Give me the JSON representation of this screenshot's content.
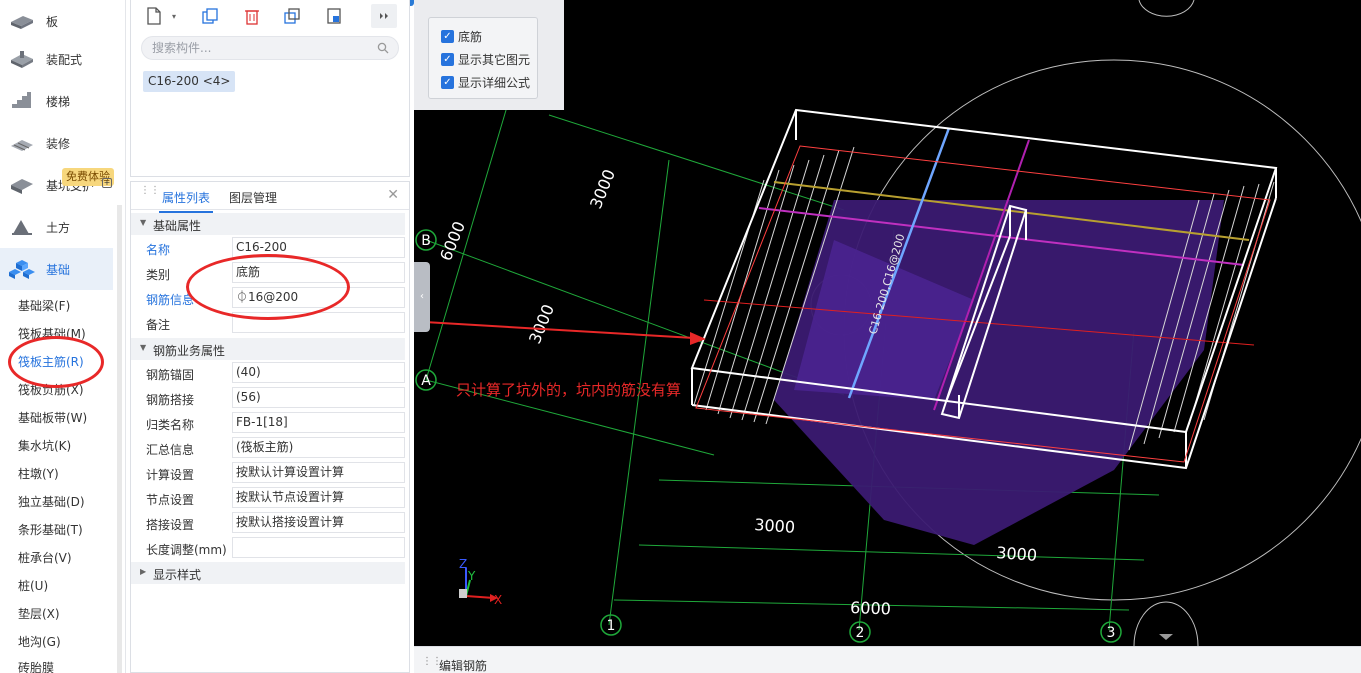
{
  "nav": {
    "items": [
      {
        "label": "板",
        "icon": "slab-icon"
      },
      {
        "label": "装配式",
        "icon": "prefab-icon"
      },
      {
        "label": "楼梯",
        "icon": "stairs-icon"
      },
      {
        "label": "装修",
        "icon": "decoration-icon"
      },
      {
        "label": "基坑支护",
        "icon": "pit-support-icon"
      },
      {
        "label": "土方",
        "icon": "earthwork-icon"
      },
      {
        "label": "基础",
        "icon": "foundation-icon"
      }
    ],
    "free_badge": "免费体验",
    "sub_items": [
      "基础梁(F)",
      "筏板基础(M)",
      "筏板主筋(R)",
      "筏板负筋(X)",
      "基础板带(W)",
      "集水坑(K)",
      "柱墩(Y)",
      "独立基础(D)",
      "条形基础(T)",
      "桩承台(V)",
      "桩(U)",
      "垫层(X)",
      "地沟(G)",
      "砖胎膜"
    ],
    "active_sub": "筏板主筋(R)"
  },
  "component_panel": {
    "search_placeholder": "搜索构件...",
    "component": "C16-200 <4>",
    "toolbar_icons": [
      "new-icon",
      "copy-icon",
      "delete-icon",
      "duplicate-icon",
      "layer-copy-icon",
      "more-icon"
    ]
  },
  "properties": {
    "tabs": [
      "属性列表",
      "图层管理"
    ],
    "groups": {
      "basic": "基础属性",
      "business": "钢筋业务属性",
      "display": "显示样式"
    },
    "basic_rows": [
      {
        "name": "名称",
        "value": "C16-200",
        "blue": true
      },
      {
        "name": "类别",
        "value": "底筋",
        "blue": false
      },
      {
        "name": "钢筋信息",
        "value": "⏀16@200",
        "blue": true
      },
      {
        "name": "备注",
        "value": "",
        "blue": false
      }
    ],
    "business_rows": [
      {
        "name": "钢筋锚固",
        "value": "(40)"
      },
      {
        "name": "钢筋搭接",
        "value": "(56)"
      },
      {
        "name": "归类名称",
        "value": "FB-1[18]"
      },
      {
        "name": "汇总信息",
        "value": "(筏板主筋)"
      },
      {
        "name": "计算设置",
        "value": "按默认计算设置计算"
      },
      {
        "name": "节点设置",
        "value": "按默认节点设置计算"
      },
      {
        "name": "搭接设置",
        "value": "按默认搭接设置计算"
      },
      {
        "name": "长度调整(mm)",
        "value": ""
      }
    ]
  },
  "viewport": {
    "checkboxes": [
      "底筋",
      "显示其它图元",
      "显示详细公式"
    ],
    "annotation": "只计算了坑外的，坑内的筋没有算",
    "rebar_label": "C16-200,C16@200",
    "dims": [
      "3000",
      "6000",
      "3000",
      "3000",
      "3000",
      "6000"
    ],
    "axis_labels": [
      "A",
      "B",
      "1",
      "2",
      "3"
    ],
    "axis_x": "X",
    "axis_y": "Y",
    "axis_z": "Z"
  },
  "statusbar": {
    "label": "编辑钢筋"
  },
  "colors": {
    "accent": "#2673dd",
    "annotation_red": "#e82828",
    "viewport_bg": "#000000",
    "purple": "#5a2a9e"
  }
}
